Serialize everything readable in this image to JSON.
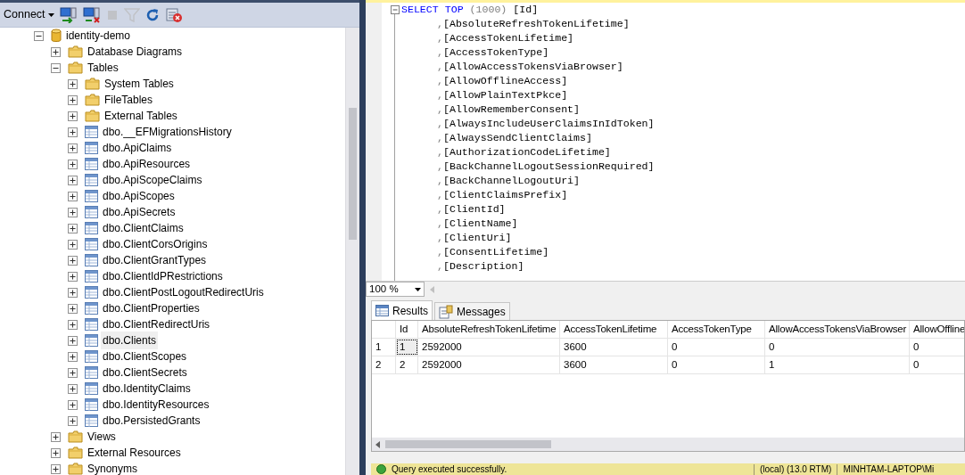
{
  "toolbar": {
    "connect_label": "Connect",
    "buttons": [
      {
        "kind": "connect",
        "disabled": false
      },
      {
        "kind": "disconnect",
        "disabled": false
      },
      {
        "kind": "stop",
        "disabled": true
      },
      {
        "kind": "filter",
        "disabled": true
      },
      {
        "kind": "refresh",
        "disabled": false
      },
      {
        "kind": "activity",
        "disabled": false
      }
    ]
  },
  "tree": [
    {
      "label": "identity-demo",
      "kind": "database",
      "expanded": true,
      "selected": false,
      "children": [
        {
          "label": "Database Diagrams",
          "kind": "folder",
          "expanded": false,
          "selected": false
        },
        {
          "label": "Tables",
          "kind": "folder",
          "expanded": true,
          "selected": false,
          "children": [
            {
              "label": "System Tables",
              "kind": "folder",
              "expanded": false,
              "selected": false
            },
            {
              "label": "FileTables",
              "kind": "folder",
              "expanded": false,
              "selected": false
            },
            {
              "label": "External Tables",
              "kind": "folder",
              "expanded": false,
              "selected": false
            },
            {
              "label": "dbo.__EFMigrationsHistory",
              "kind": "table",
              "expanded": false,
              "selected": false
            },
            {
              "label": "dbo.ApiClaims",
              "kind": "table",
              "expanded": false,
              "selected": false
            },
            {
              "label": "dbo.ApiResources",
              "kind": "table",
              "expanded": false,
              "selected": false
            },
            {
              "label": "dbo.ApiScopeClaims",
              "kind": "table",
              "expanded": false,
              "selected": false
            },
            {
              "label": "dbo.ApiScopes",
              "kind": "table",
              "expanded": false,
              "selected": false
            },
            {
              "label": "dbo.ApiSecrets",
              "kind": "table",
              "expanded": false,
              "selected": false
            },
            {
              "label": "dbo.ClientClaims",
              "kind": "table",
              "expanded": false,
              "selected": false
            },
            {
              "label": "dbo.ClientCorsOrigins",
              "kind": "table",
              "expanded": false,
              "selected": false
            },
            {
              "label": "dbo.ClientGrantTypes",
              "kind": "table",
              "expanded": false,
              "selected": false
            },
            {
              "label": "dbo.ClientIdPRestrictions",
              "kind": "table",
              "expanded": false,
              "selected": false
            },
            {
              "label": "dbo.ClientPostLogoutRedirectUris",
              "kind": "table",
              "expanded": false,
              "selected": false
            },
            {
              "label": "dbo.ClientProperties",
              "kind": "table",
              "expanded": false,
              "selected": false
            },
            {
              "label": "dbo.ClientRedirectUris",
              "kind": "table",
              "expanded": false,
              "selected": false
            },
            {
              "label": "dbo.Clients",
              "kind": "table",
              "expanded": false,
              "selected": true
            },
            {
              "label": "dbo.ClientScopes",
              "kind": "table",
              "expanded": false,
              "selected": false
            },
            {
              "label": "dbo.ClientSecrets",
              "kind": "table",
              "expanded": false,
              "selected": false
            },
            {
              "label": "dbo.IdentityClaims",
              "kind": "table",
              "expanded": false,
              "selected": false
            },
            {
              "label": "dbo.IdentityResources",
              "kind": "table",
              "expanded": false,
              "selected": false
            },
            {
              "label": "dbo.PersistedGrants",
              "kind": "table",
              "expanded": false,
              "selected": false
            }
          ]
        },
        {
          "label": "Views",
          "kind": "folder",
          "expanded": false,
          "selected": false
        },
        {
          "label": "External Resources",
          "kind": "folder",
          "expanded": false,
          "selected": false
        },
        {
          "label": "Synonyms",
          "kind": "folder",
          "expanded": false,
          "selected": false
        }
      ]
    }
  ],
  "query": {
    "lines": [
      {
        "tokens": [
          {
            "kind": "keyword",
            "text": "SELECT"
          },
          {
            "kind": "keyword",
            "text": "TOP"
          },
          {
            "kind": "punct",
            "text": "(1000)"
          },
          {
            "kind": "plain",
            "text": "[Id]"
          }
        ]
      },
      {
        "tokens": [
          {
            "kind": "punct",
            "text": ","
          },
          {
            "kind": "plain",
            "text": "[AbsoluteRefreshTokenLifetime]"
          }
        ]
      },
      {
        "tokens": [
          {
            "kind": "punct",
            "text": ","
          },
          {
            "kind": "plain",
            "text": "[AccessTokenLifetime]"
          }
        ]
      },
      {
        "tokens": [
          {
            "kind": "punct",
            "text": ","
          },
          {
            "kind": "plain",
            "text": "[AccessTokenType]"
          }
        ]
      },
      {
        "tokens": [
          {
            "kind": "punct",
            "text": ","
          },
          {
            "kind": "plain",
            "text": "[AllowAccessTokensViaBrowser]"
          }
        ]
      },
      {
        "tokens": [
          {
            "kind": "punct",
            "text": ","
          },
          {
            "kind": "plain",
            "text": "[AllowOfflineAccess]"
          }
        ]
      },
      {
        "tokens": [
          {
            "kind": "punct",
            "text": ","
          },
          {
            "kind": "plain",
            "text": "[AllowPlainTextPkce]"
          }
        ]
      },
      {
        "tokens": [
          {
            "kind": "punct",
            "text": ","
          },
          {
            "kind": "plain",
            "text": "[AllowRememberConsent]"
          }
        ]
      },
      {
        "tokens": [
          {
            "kind": "punct",
            "text": ","
          },
          {
            "kind": "plain",
            "text": "[AlwaysIncludeUserClaimsInIdToken]"
          }
        ]
      },
      {
        "tokens": [
          {
            "kind": "punct",
            "text": ","
          },
          {
            "kind": "plain",
            "text": "[AlwaysSendClientClaims]"
          }
        ]
      },
      {
        "tokens": [
          {
            "kind": "punct",
            "text": ","
          },
          {
            "kind": "plain",
            "text": "[AuthorizationCodeLifetime]"
          }
        ]
      },
      {
        "tokens": [
          {
            "kind": "punct",
            "text": ","
          },
          {
            "kind": "plain",
            "text": "[BackChannelLogoutSessionRequired]"
          }
        ]
      },
      {
        "tokens": [
          {
            "kind": "punct",
            "text": ","
          },
          {
            "kind": "plain",
            "text": "[BackChannelLogoutUri]"
          }
        ]
      },
      {
        "tokens": [
          {
            "kind": "punct",
            "text": ","
          },
          {
            "kind": "plain",
            "text": "[ClientClaimsPrefix]"
          }
        ]
      },
      {
        "tokens": [
          {
            "kind": "punct",
            "text": ","
          },
          {
            "kind": "plain",
            "text": "[ClientId]"
          }
        ]
      },
      {
        "tokens": [
          {
            "kind": "punct",
            "text": ","
          },
          {
            "kind": "plain",
            "text": "[ClientName]"
          }
        ]
      },
      {
        "tokens": [
          {
            "kind": "punct",
            "text": ","
          },
          {
            "kind": "plain",
            "text": "[ClientUri]"
          }
        ]
      },
      {
        "tokens": [
          {
            "kind": "punct",
            "text": ","
          },
          {
            "kind": "plain",
            "text": "[ConsentLifetime]"
          }
        ]
      },
      {
        "tokens": [
          {
            "kind": "punct",
            "text": ","
          },
          {
            "kind": "plain",
            "text": "[Description]"
          }
        ]
      }
    ],
    "zoom": "100 %"
  },
  "result_tabs": [
    {
      "label": "Results",
      "kind": "grid",
      "selected": true
    },
    {
      "label": "Messages",
      "kind": "messages",
      "selected": false
    }
  ],
  "grid": {
    "columns": [
      "Id",
      "AbsoluteRefreshTokenLifetime",
      "AccessTokenLifetime",
      "AccessTokenType",
      "AllowAccessTokensViaBrowser",
      "AllowOffline"
    ],
    "rows": [
      {
        "number": "1",
        "cells": [
          {
            "text": "1",
            "focused": true
          },
          {
            "text": "2592000",
            "focused": false
          },
          {
            "text": "3600",
            "focused": false
          },
          {
            "text": "0",
            "focused": false
          },
          {
            "text": "0",
            "focused": false
          },
          {
            "text": "0",
            "focused": false
          }
        ]
      },
      {
        "number": "2",
        "cells": [
          {
            "text": "2",
            "focused": false
          },
          {
            "text": "2592000",
            "focused": false
          },
          {
            "text": "3600",
            "focused": false
          },
          {
            "text": "0",
            "focused": false
          },
          {
            "text": "1",
            "focused": false
          },
          {
            "text": "0",
            "focused": false
          }
        ]
      }
    ]
  },
  "status_bar": {
    "message": "Query executed successfully.",
    "server": "(local) (13.0 RTM)",
    "user": "MINHTAM-LAPTOP\\Mi"
  }
}
